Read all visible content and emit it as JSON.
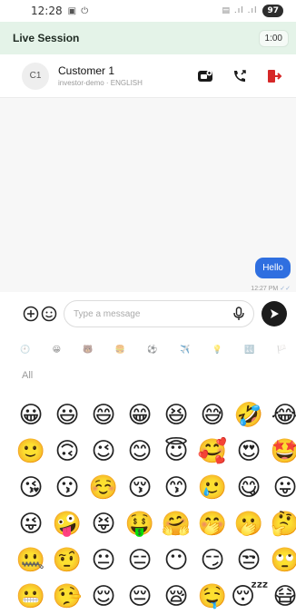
{
  "status_bar": {
    "time": "12:28",
    "icons_left": "▣ ⏻",
    "signal": "▤ .ıl .ıl",
    "battery": "97"
  },
  "session": {
    "title": "Live Session",
    "timer": "1:00",
    "accent_color": "#e4f3e8"
  },
  "customer": {
    "avatar_initials": "C1",
    "name": "Customer 1",
    "meta": "investor-demo · ENGLISH"
  },
  "header_actions": [
    "video-icon",
    "call-transfer-icon",
    "exit-icon"
  ],
  "messages": [
    {
      "direction": "outgoing",
      "text": "Hello",
      "time": "12:27 PM",
      "status": "✓✓"
    }
  ],
  "composer": {
    "placeholder": "Type a message",
    "icons": [
      "add-icon",
      "emoji-icon",
      "mic-icon",
      "send-icon"
    ]
  },
  "emoji_categories": [
    "🕘",
    "😀",
    "🐻",
    "🍔",
    "⚽",
    "✈️",
    "💡",
    "🔣",
    "🏳️"
  ],
  "emoji_section_label": "All",
  "emojis": [
    "😀",
    "😃",
    "😄",
    "😁",
    "😆",
    "😅",
    "🤣",
    "😂",
    "🙂",
    "🙃",
    "😉",
    "😊",
    "😇",
    "🥰",
    "😍",
    "🤩",
    "😘",
    "😗",
    "☺️",
    "😚",
    "😙",
    "🥲",
    "😋",
    "😛",
    "😜",
    "🤪",
    "😝",
    "🤑",
    "🤗",
    "🤭",
    "🫢",
    "🤔",
    "🤐",
    "🤨",
    "😐",
    "😑",
    "😶",
    "😏",
    "😒",
    "🙄",
    "😬",
    "🤥",
    "😌",
    "😔",
    "😪",
    "🤤",
    "😴",
    "😷"
  ]
}
